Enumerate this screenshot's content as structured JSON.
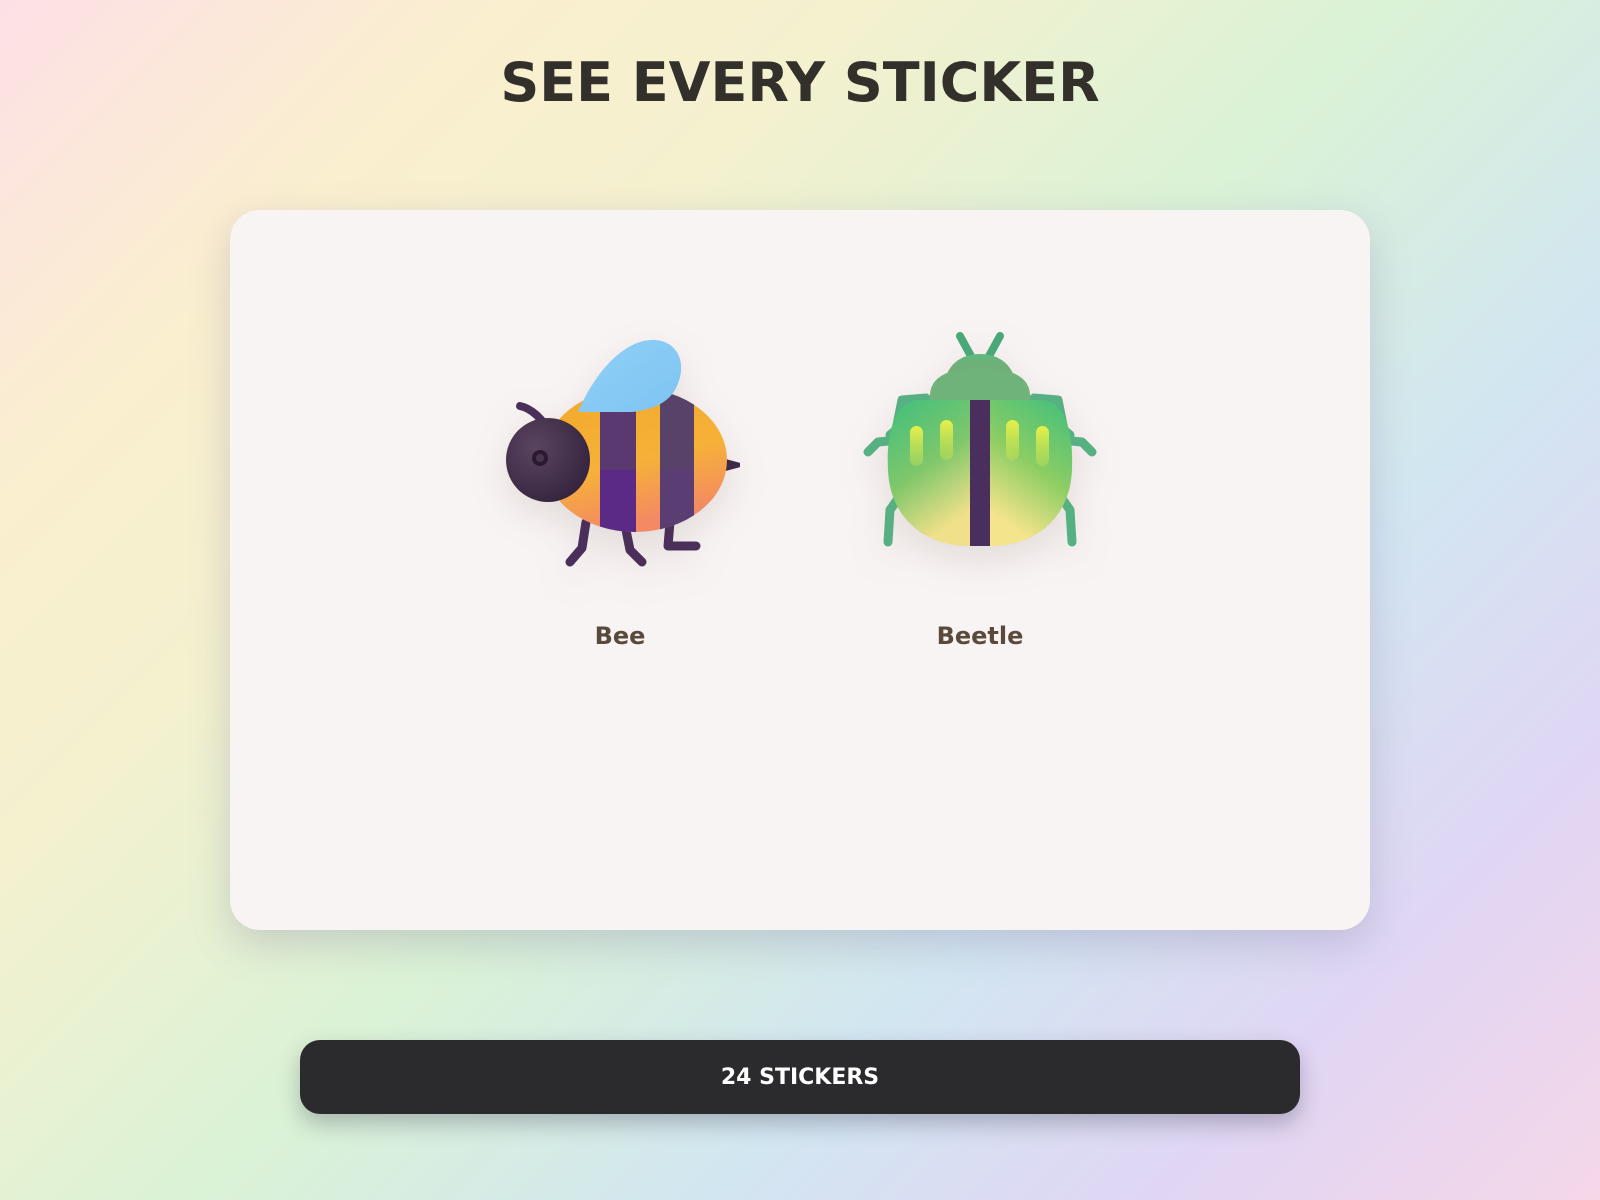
{
  "page": {
    "title": "SEE EVERY STICKER"
  },
  "stickers": [
    {
      "name": "Bee",
      "icon": "bee-icon"
    },
    {
      "name": "Beetle",
      "icon": "beetle-icon"
    }
  ],
  "footer": {
    "count_label": "24 STICKERS"
  },
  "colors": {
    "button_bg": "#2b2b2d",
    "title_color": "#332f2b",
    "label_color": "#5a4a3c",
    "card_bg": "#f9f4f4"
  }
}
